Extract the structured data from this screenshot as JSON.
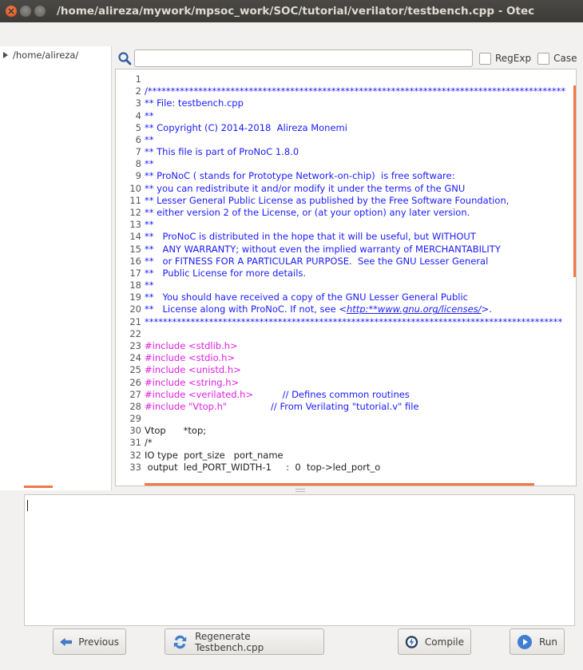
{
  "window": {
    "title": "/home/alireza/mywork/mpsoc_work/SOC/tutorial/verilator/testbench.cpp - Otec"
  },
  "tree": {
    "root_label": "/home/alireza/"
  },
  "search": {
    "value": "",
    "regexp_label": "RegExp",
    "case_label": "Case"
  },
  "editor": {
    "lines": [
      {
        "n": "1",
        "t": "",
        "k": "norm"
      },
      {
        "n": "2",
        "t": "/*******************************************************************************************",
        "k": "comment"
      },
      {
        "n": "3",
        "t": "** File: testbench.cpp",
        "k": "comment"
      },
      {
        "n": "4",
        "t": "**",
        "k": "comment"
      },
      {
        "n": "5",
        "t": "** Copyright (C) 2014-2018  Alireza Monemi",
        "k": "comment"
      },
      {
        "n": "6",
        "t": "**",
        "k": "comment"
      },
      {
        "n": "7",
        "t": "** This file is part of ProNoC 1.8.0",
        "k": "comment"
      },
      {
        "n": "8",
        "t": "**",
        "k": "comment"
      },
      {
        "n": "9",
        "t": "** ProNoC ( stands for Prototype Network-on-chip)  is free software:",
        "k": "comment"
      },
      {
        "n": "10",
        "t": "** you can redistribute it and/or modify it under the terms of the GNU",
        "k": "comment"
      },
      {
        "n": "11",
        "t": "** Lesser General Public License as published by the Free Software Foundation,",
        "k": "comment"
      },
      {
        "n": "12",
        "t": "** either version 2 of the License, or (at your option) any later version.",
        "k": "comment"
      },
      {
        "n": "13",
        "t": "**",
        "k": "comment"
      },
      {
        "n": "14",
        "t": "**   ProNoC is distributed in the hope that it will be useful, but WITHOUT",
        "k": "comment"
      },
      {
        "n": "15",
        "t": "**   ANY WARRANTY; without even the implied warranty of MERCHANTABILITY",
        "k": "comment"
      },
      {
        "n": "16",
        "t": "**   or FITNESS FOR A PARTICULAR PURPOSE.  See the GNU Lesser General",
        "k": "comment"
      },
      {
        "n": "17",
        "t": "**   Public License for more details.",
        "k": "comment"
      },
      {
        "n": "18",
        "t": "**",
        "k": "comment"
      },
      {
        "n": "19",
        "t": "**   You should have received a copy of the GNU Lesser General Public",
        "k": "comment"
      },
      {
        "n": "20",
        "t": "**   License along with ProNoC. If not, see <",
        "k": "comment",
        "link": "http:**www.gnu.org/licenses/",
        "after": ">."
      },
      {
        "n": "21",
        "t": "*******************************************************************************************",
        "k": "comment"
      },
      {
        "n": "22",
        "t": "",
        "k": "norm"
      },
      {
        "n": "23",
        "t": "#include <stdlib.h>",
        "k": "pre"
      },
      {
        "n": "24",
        "t": "#include <stdio.h>",
        "k": "pre"
      },
      {
        "n": "25",
        "t": "#include <unistd.h>",
        "k": "pre"
      },
      {
        "n": "26",
        "t": "#include <string.h>",
        "k": "pre"
      },
      {
        "n": "27",
        "t": "#include <verilated.h>",
        "k": "pre",
        "trail": "          // Defines common routines"
      },
      {
        "n": "28",
        "t": "#include \"Vtop.h\"",
        "k": "pre",
        "trail": "               // From Verilating \"tutorial.v\" file"
      },
      {
        "n": "29",
        "t": "",
        "k": "norm"
      },
      {
        "n": "30",
        "t": "Vtop      *top;",
        "k": "norm"
      },
      {
        "n": "31",
        "t": "/*",
        "k": "norm"
      },
      {
        "n": "32",
        "t": "IO type  port_size   port_name",
        "k": "norm"
      },
      {
        "n": "33",
        "t": " output  led_PORT_WIDTH-1     :  0  top->led_port_o",
        "k": "norm"
      }
    ]
  },
  "console": {
    "text": ""
  },
  "buttons": {
    "previous": "Previous",
    "regenerate": "Regenerate Testbench.cpp",
    "compile": "Compile",
    "run": "Run"
  },
  "colors": {
    "accent": "#f07746",
    "comment": "#1a1aff",
    "preprocessor": "#e01ee0"
  }
}
